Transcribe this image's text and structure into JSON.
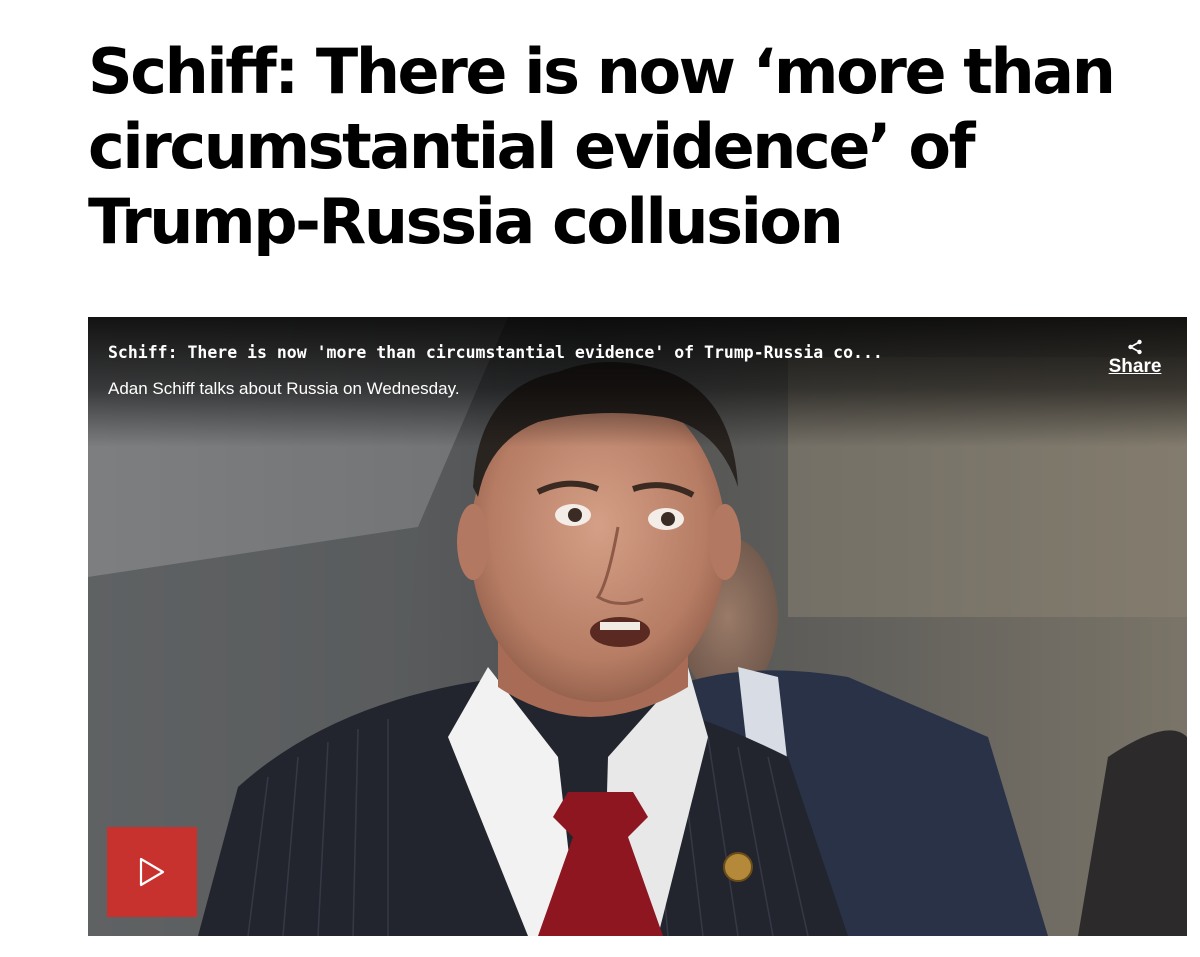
{
  "article": {
    "headline": "Schiff: There is now ‘more than circumstantial evidence’ of Trump-Russia collusion"
  },
  "video": {
    "title": "Schiff: There is now 'more than circumstantial evidence' of Trump-Russia co...",
    "caption": "Adan Schiff talks about Russia on Wednesday.",
    "share_label": "Share",
    "share_icon": "share-icon",
    "play_icon": "play-icon",
    "thumbnail_alt": "Adam Schiff speaking to reporters",
    "colors": {
      "play_button": "#c8322e",
      "overlay_text": "#ffffff"
    }
  }
}
